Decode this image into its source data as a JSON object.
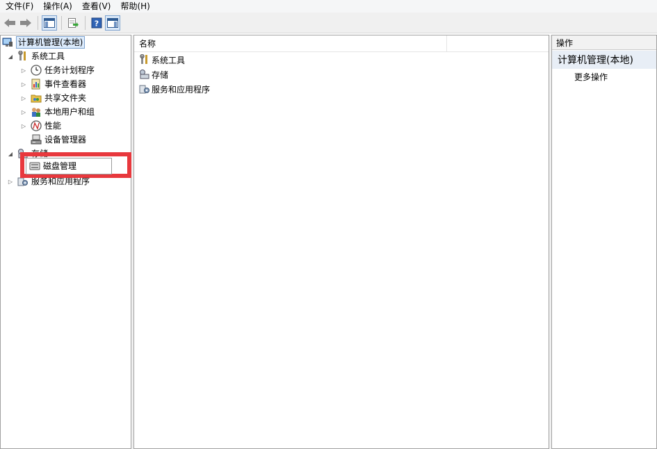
{
  "menubar": {
    "file": "文件(F)",
    "action": "操作(A)",
    "view": "查看(V)",
    "help": "帮助(H)"
  },
  "toolbar": {
    "buttons": [
      "back-arrow-icon",
      "forward-arrow-icon",
      "show-hide-console-tree-icon",
      "export-list-icon",
      "help-icon",
      "show-hide-action-pane-icon"
    ]
  },
  "tree": {
    "root": "计算机管理(本地)",
    "system_tools": "系统工具",
    "task_scheduler": "任务计划程序",
    "event_viewer": "事件查看器",
    "shared_folders": "共享文件夹",
    "local_users": "本地用户和组",
    "performance": "性能",
    "device_manager": "设备管理器",
    "storage": "存储",
    "disk_management": "磁盘管理",
    "services_apps": "服务和应用程序"
  },
  "center": {
    "column_name": "名称",
    "items": [
      "系统工具",
      "存储",
      "服务和应用程序"
    ]
  },
  "actions": {
    "header": "操作",
    "subheader": "计算机管理(本地)",
    "more": "更多操作"
  },
  "colors": {
    "highlight_red": "#e8383d",
    "selection_blue": "#7da2ce"
  }
}
